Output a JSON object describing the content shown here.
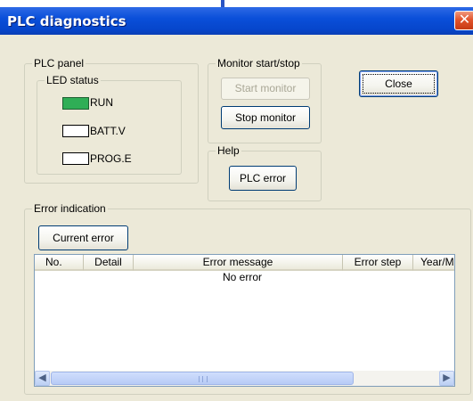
{
  "window": {
    "title": "PLC diagnostics",
    "close_glyph": "✕"
  },
  "plc_panel": {
    "legend": "PLC panel",
    "led_status": {
      "legend": "LED status",
      "leds": [
        {
          "label": "RUN",
          "state": "on",
          "color": "#2fae56"
        },
        {
          "label": "BATT.V",
          "state": "off",
          "color": "#ffffff"
        },
        {
          "label": "PROG.E",
          "state": "off",
          "color": "#ffffff"
        }
      ]
    }
  },
  "monitor": {
    "legend": "Monitor start/stop",
    "start_label": "Start monitor",
    "stop_label": "Stop monitor"
  },
  "close_label": "Close",
  "help": {
    "legend": "Help",
    "plc_error_label": "PLC error"
  },
  "error_indication": {
    "legend": "Error indication",
    "current_error_label": "Current error",
    "columns": [
      "No.",
      "Detail",
      "Error message",
      "Error step",
      "Year/M"
    ],
    "rows": [
      {
        "error_message": "No error"
      }
    ],
    "scroll_left_icon": "scroll-left-arrow",
    "scroll_right_icon": "scroll-right-arrow"
  }
}
